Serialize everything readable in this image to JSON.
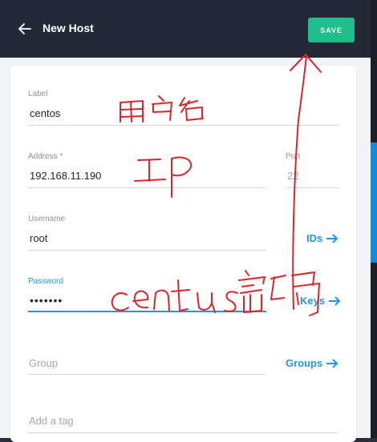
{
  "header": {
    "title": "New Host",
    "save_label": "SAVE"
  },
  "form": {
    "label": {
      "label": "Label",
      "value": "centos"
    },
    "address": {
      "label": "Address *",
      "value": "192.168.11.190"
    },
    "port": {
      "label": "Port",
      "placeholder": "22"
    },
    "username": {
      "label": "Username",
      "value": "root"
    },
    "ids_link": "IDs",
    "password": {
      "label": "Password",
      "value": "•••••••"
    },
    "keys_link": "Keys",
    "group": {
      "placeholder": "Group"
    },
    "groups_link": "Groups",
    "tag": {
      "placeholder": "Add a tag"
    }
  },
  "annotations": {
    "username_note": "用户名",
    "ip_note": "IP",
    "password_note": "centos密码"
  },
  "colors": {
    "accent": "#2196e8",
    "save": "#1fbe8a",
    "header": "#252837",
    "annotation": "#d8262b"
  }
}
